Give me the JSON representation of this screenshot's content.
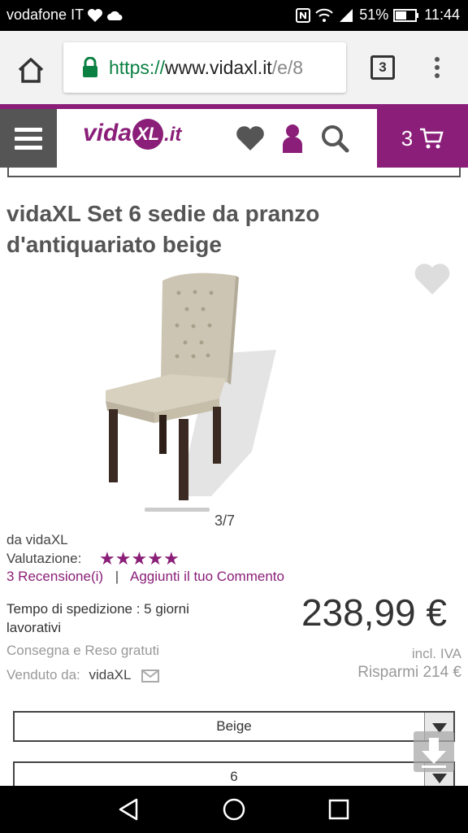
{
  "status_bar": {
    "carrier": "vodafone IT",
    "battery": "51%",
    "time": "11:44"
  },
  "browser": {
    "url_https": "https://",
    "url_host": "www.vidaxl.it",
    "url_rest": "/e/8",
    "tab_count": "3"
  },
  "site": {
    "logo_prefix": "vida",
    "logo_xl": "XL",
    "logo_suffix": ".it",
    "cart_count": "3"
  },
  "product": {
    "title": "vidaXL Set 6 sedie da pranzo d'antiquariato beige",
    "image_counter": "3/7",
    "brand_line": "da vidaXL",
    "rating_label": "Valutazione:",
    "rating_stars": 5,
    "reviews_link": "3 Recensione(i)",
    "separator": "|",
    "add_comment_link": "Aggiunti il tuo Commento",
    "shipping_time": "Tempo di spedizione : 5 giorni lavorativi",
    "price": "238,99 €",
    "free_delivery": "Consegna e Reso gratuti",
    "vat": "incl. IVA",
    "sold_by_label": "Venduto da:",
    "seller": "vidaXL",
    "savings": "Risparmi 214 €"
  },
  "options": {
    "color_selected": "Beige",
    "quantity_selected": "6"
  },
  "colors": {
    "brand": "#8a1e78",
    "header_dark": "#555555"
  }
}
